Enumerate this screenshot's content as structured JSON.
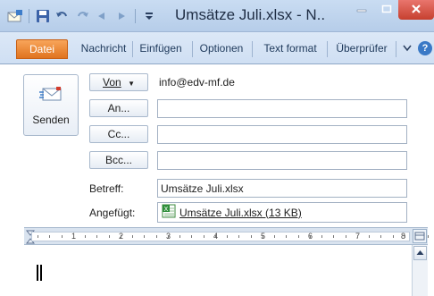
{
  "window": {
    "title": "Umsätze Juli.xlsx - N..",
    "min_icon": "minimize-icon",
    "max_icon": "maximize-icon",
    "close_icon": "close-icon"
  },
  "quick_access": [
    "save-icon",
    "undo-icon",
    "redo-icon",
    "prev-item-icon",
    "next-item-icon",
    "customize-dropdown-icon"
  ],
  "ribbon": {
    "tabs": [
      "Datei",
      "Nachricht",
      "Einfügen",
      "Optionen",
      "Text format",
      "Überprüfer"
    ],
    "active_tab": "Datei",
    "colors": {
      "file_tab": "#e0731f",
      "title_bar": "#c9dcf2",
      "close": "#c6402f"
    }
  },
  "header": {
    "send_label": "Senden",
    "from_button": "Von",
    "from_value": "info@edv-mf.de",
    "to_button": "An...",
    "cc_button": "Cc...",
    "bcc_button": "Bcc...",
    "subject_label": "Betreff:",
    "subject_value": "Umsätze Juli.xlsx",
    "attached_label": "Angefügt:",
    "attachment": "Umsätze Juli.xlsx (13 KB)"
  },
  "ruler": {
    "numbers": [
      "1",
      "2",
      "3",
      "4",
      "5",
      "6",
      "7",
      "8"
    ]
  }
}
